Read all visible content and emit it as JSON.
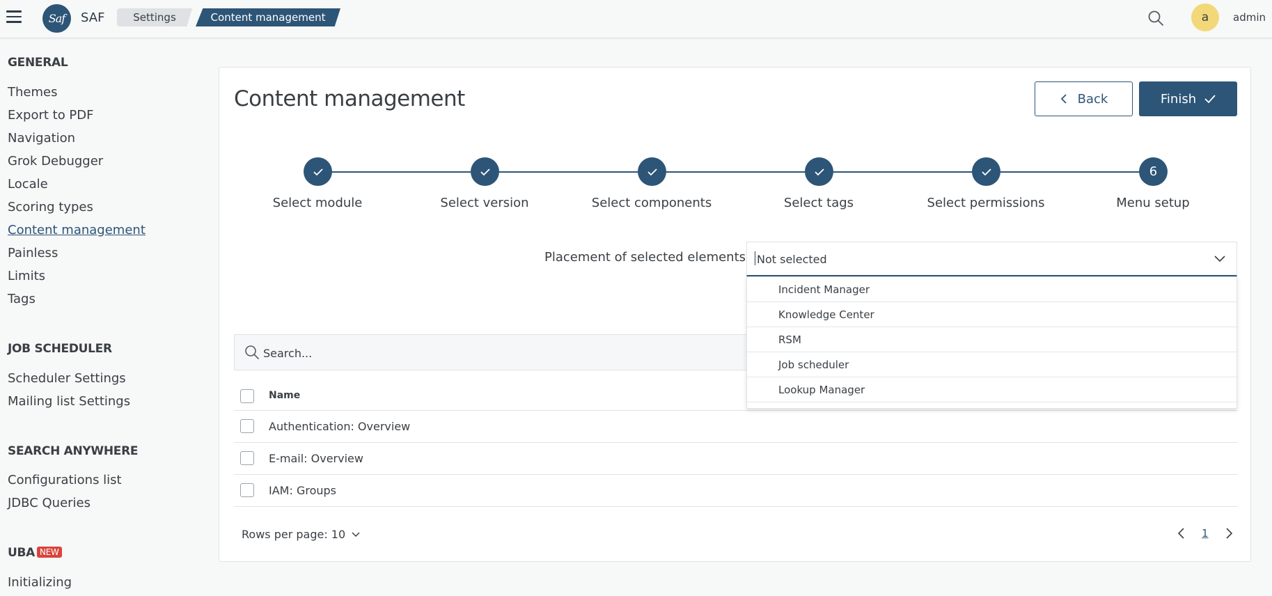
{
  "app": {
    "name": "SAF",
    "logo_text": "Saf"
  },
  "breadcrumbs": [
    "Settings",
    "Content management"
  ],
  "user": {
    "initial": "a",
    "name": "admin"
  },
  "sidebar": {
    "sections": [
      {
        "title": "GENERAL",
        "items": [
          "Themes",
          "Export to PDF",
          "Navigation",
          "Grok Debugger",
          "Locale",
          "Scoring types",
          "Content management",
          "Painless",
          "Limits",
          "Tags"
        ]
      },
      {
        "title": "JOB SCHEDULER",
        "items": [
          "Scheduler Settings",
          "Mailing list Settings"
        ]
      },
      {
        "title": "SEARCH ANYWHERE",
        "items": [
          "Configurations list",
          "JDBC Queries"
        ]
      },
      {
        "title": "UBA",
        "badge": "NEW",
        "items": [
          "Initializing"
        ]
      }
    ],
    "active_item": "Content management"
  },
  "page": {
    "title": "Content management",
    "back_label": "Back",
    "finish_label": "Finish"
  },
  "stepper": {
    "steps": [
      {
        "label": "Select module",
        "state": "done"
      },
      {
        "label": "Select version",
        "state": "done"
      },
      {
        "label": "Select components",
        "state": "done"
      },
      {
        "label": "Select tags",
        "state": "done"
      },
      {
        "label": "Select permissions",
        "state": "done"
      },
      {
        "label": "Menu setup",
        "state": "current",
        "number": "6"
      }
    ]
  },
  "placement": {
    "label": "Placement of selected elements:",
    "value": "Not selected",
    "options": [
      "Incident Manager",
      "Knowledge Center",
      "RSM",
      "Job scheduler",
      "Lookup Manager"
    ]
  },
  "search": {
    "placeholder": "Search..."
  },
  "table": {
    "header": "Name",
    "rows": [
      "Authentication: Overview",
      "E-mail: Overview",
      "IAM: Groups"
    ]
  },
  "pagination": {
    "rows_per_page_label": "Rows per page: 10",
    "current_page": "1"
  },
  "colors": {
    "primary": "#2d5577",
    "badge": "#d9443b",
    "avatar": "#f3d87a"
  }
}
